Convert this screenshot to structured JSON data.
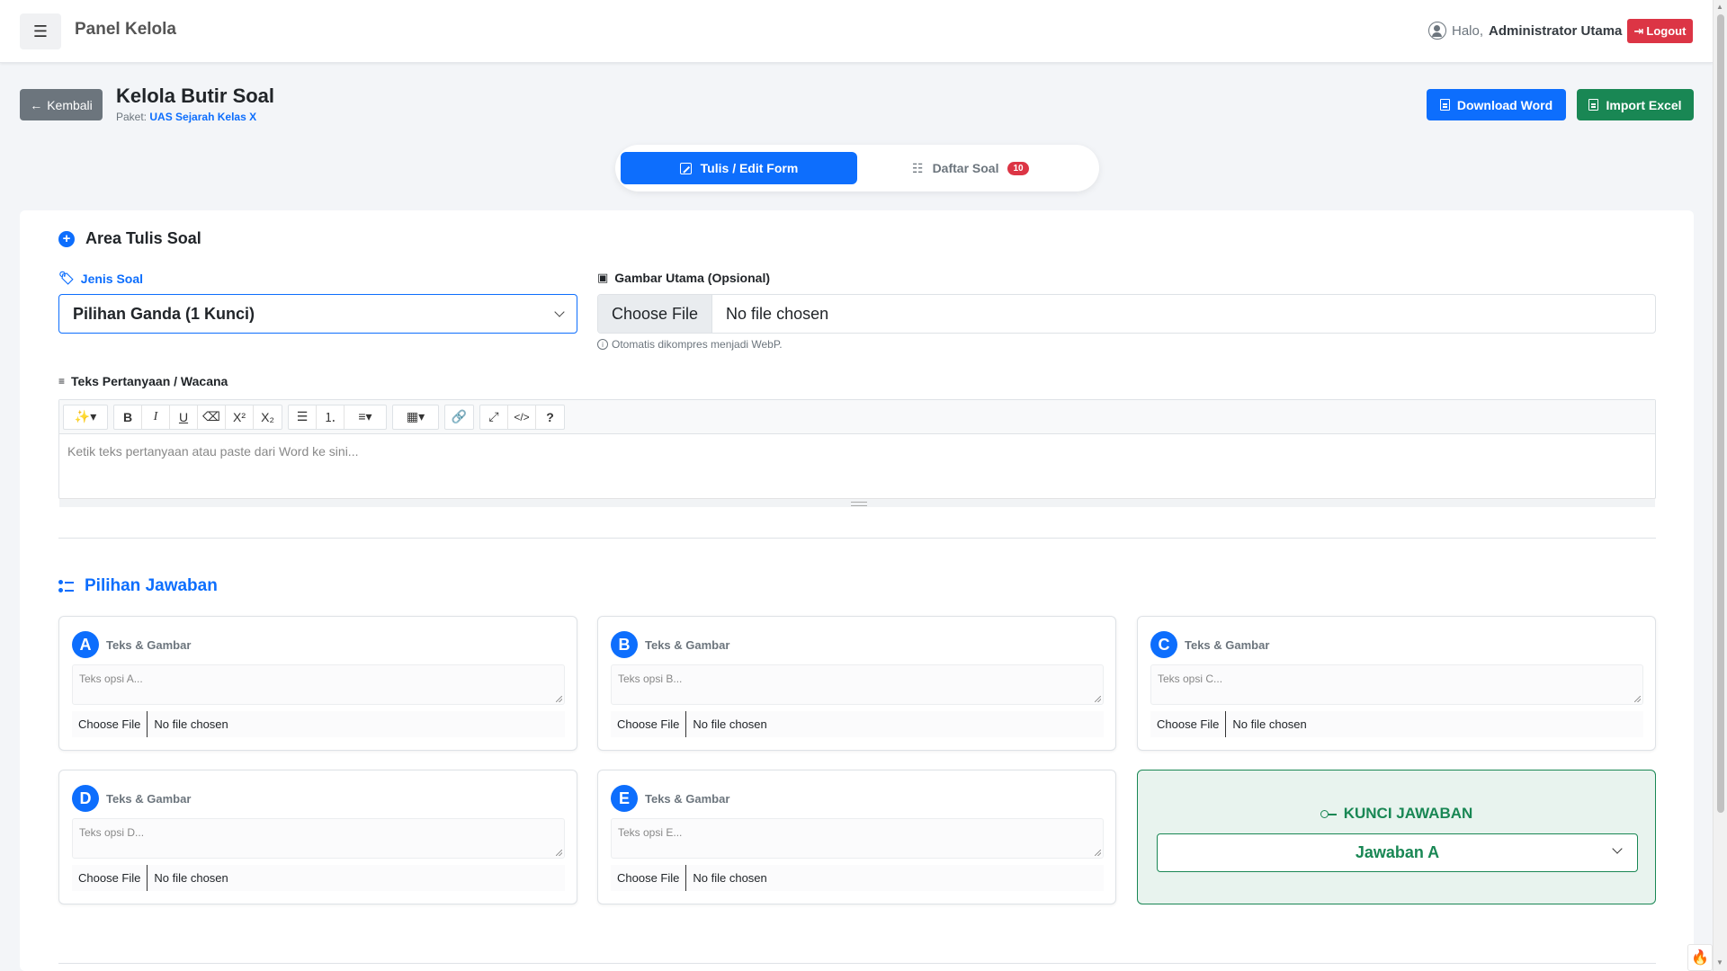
{
  "navbar": {
    "brand": "Panel Kelola",
    "greeting_prefix": "Halo,",
    "user_name": "Administrator Utama",
    "logout_label": "Logout"
  },
  "header": {
    "back_label": "Kembali",
    "title": "Kelola Butir Soal",
    "paket_label": "Paket:",
    "paket_name": "UAS Sejarah Kelas X",
    "download_word_label": "Download Word",
    "import_excel_label": "Import Excel"
  },
  "tabs": {
    "edit_label": "Tulis / Edit Form",
    "list_label": "Daftar Soal",
    "list_count": "10"
  },
  "form": {
    "section_title": "Area Tulis Soal",
    "jenis_label": "Jenis Soal",
    "jenis_value": "Pilihan Ganda (1 Kunci)",
    "gambar_label": "Gambar Utama (Opsional)",
    "file_button": "Choose File",
    "file_status": "No file chosen",
    "gambar_hint": "Otomatis dikompres menjadi WebP.",
    "teks_label": "Teks Pertanyaan / Wacana",
    "editor_placeholder": "Ketik teks pertanyaan atau paste dari Word ke sini..."
  },
  "toolbar": {
    "buttons": [
      "magic",
      "bold",
      "italic",
      "underline",
      "eraser",
      "superscript",
      "subscript",
      "unordered-list",
      "ordered-list",
      "align",
      "table",
      "link",
      "fullscreen",
      "code-view",
      "help"
    ]
  },
  "options": {
    "section_title": "Pilihan Jawaban",
    "type_label": "Teks & Gambar",
    "items": [
      {
        "letter": "A",
        "placeholder": "Teks opsi A..."
      },
      {
        "letter": "B",
        "placeholder": "Teks opsi B..."
      },
      {
        "letter": "C",
        "placeholder": "Teks opsi C..."
      },
      {
        "letter": "D",
        "placeholder": "Teks opsi D..."
      },
      {
        "letter": "E",
        "placeholder": "Teks opsi E..."
      }
    ],
    "file_button": "Choose File",
    "file_status": "No file chosen"
  },
  "kunci": {
    "title": "KUNCI JAWABAN",
    "value": "Jawaban A"
  },
  "colors": {
    "primary": "#0d6efd",
    "success": "#198754",
    "danger": "#dc3545",
    "secondary": "#6c757d"
  }
}
